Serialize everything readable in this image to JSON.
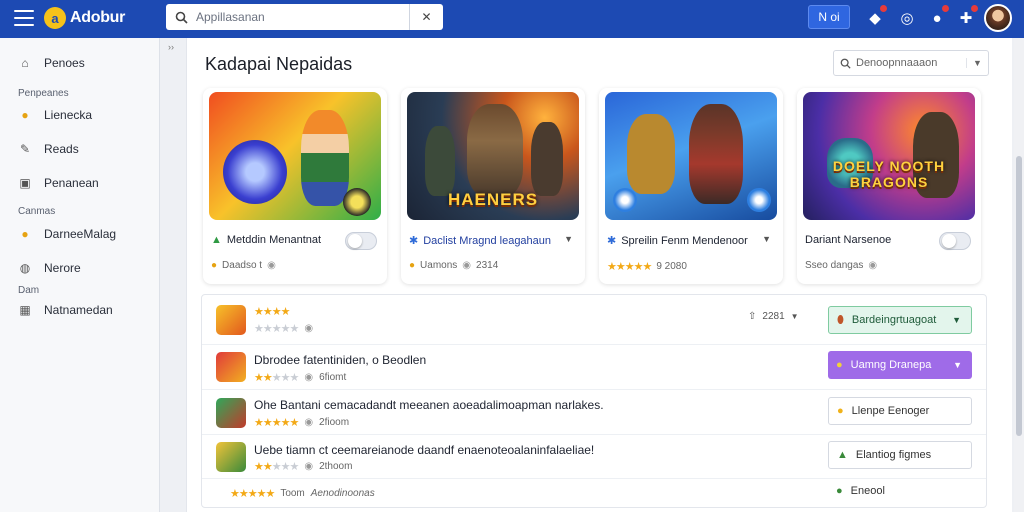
{
  "app": {
    "name": "Adobur"
  },
  "search": {
    "placeholder": "Appillasanan"
  },
  "topbar": {
    "pill_label": "N oi"
  },
  "sidebar": {
    "items": [
      {
        "label": "Penoes",
        "icon": "home-icon"
      },
      {
        "label": "Penpeanes",
        "type": "heading"
      },
      {
        "label": "Lienecka",
        "icon": "coin-icon"
      },
      {
        "label": "Reads",
        "icon": "pen-icon"
      },
      {
        "label": "Penanean",
        "icon": "image-icon"
      },
      {
        "label": "Canmas",
        "type": "heading"
      },
      {
        "label": "DarneeMalag",
        "icon": "coin-icon"
      },
      {
        "label": "Nerore",
        "icon": "globe-icon"
      },
      {
        "label": "Dam",
        "type": "heading"
      },
      {
        "label": "Natnamedan",
        "icon": "grid-icon"
      }
    ]
  },
  "main": {
    "title": "Kadapai Nepaidas",
    "sort_label": "Denoopnnaaaon"
  },
  "cards": [
    {
      "title": "Metddin Menantnat",
      "meta": "Daadso t",
      "image_caption": "",
      "control": "toggle",
      "rating_stars": 0
    },
    {
      "title": "Daclist Mragnd leagahaun",
      "meta": "Uamons",
      "meta2": "2314",
      "image_caption": "HAENERS",
      "control": "dropdown"
    },
    {
      "title": "Spreilin Fenm Mendenoor",
      "meta": "9 2080",
      "image_caption": "",
      "control": "dropdown",
      "rating_stars": 5
    },
    {
      "title": "Dariant Narsenoe",
      "meta": "Sseo dangas",
      "image_caption": "DOELY NOOTH BRAGONS",
      "control": "toggle"
    }
  ],
  "list": [
    {
      "title": "",
      "meta": "",
      "rating": 4,
      "share_count": "2281",
      "button_label": "Bardeingrtuagoat",
      "button_style": "green"
    },
    {
      "title": "Dbrodee fatentiniden, o Beodlen",
      "meta": "6fiomt",
      "rating": 2,
      "button_label": "Uamng Dranepa",
      "button_style": "purple"
    },
    {
      "title": "Ohe Bantani cemacadandt meeanen aoeadalimoapman narlakes.",
      "meta": "2fioom",
      "rating": 5,
      "button_label": "Llenpe Eenoger",
      "button_style": "plain"
    },
    {
      "title": "Uebe tiamn ct ceemareianode daandf enaenoteoalaninfalaeliae!",
      "meta": "2thoom",
      "rating": 2,
      "button_label": "Elantiog figmes",
      "button_style": "plain"
    },
    {
      "title": "",
      "meta": "Toom",
      "meta2": "Aenodinoonas",
      "rating": 5,
      "button_label": "Eneool",
      "button_style": "bare"
    }
  ]
}
